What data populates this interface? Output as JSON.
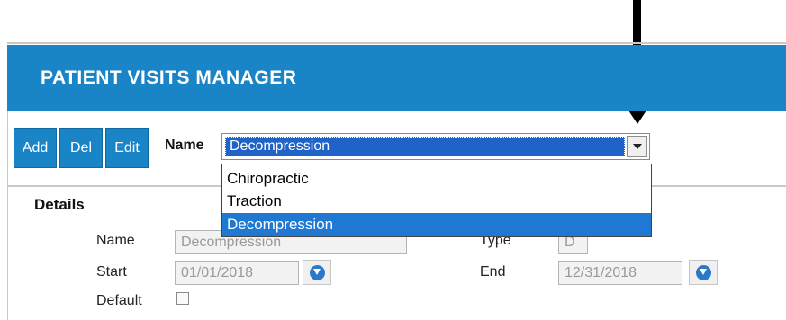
{
  "window": {
    "title": "PATIENT VISITS MANAGER"
  },
  "toolbar": {
    "add_label": "Add",
    "del_label": "Del",
    "edit_label": "Edit"
  },
  "name_selector": {
    "label": "Name",
    "selected": "Decompression",
    "options": [
      "Chiropractic",
      "Traction",
      "Decompression"
    ],
    "highlighted_index": 2
  },
  "details": {
    "title": "Details",
    "name_label": "Name",
    "name_value": "Decompression",
    "type_label": "Type",
    "type_value": "D",
    "start_label": "Start",
    "start_value": "01/01/2018",
    "end_label": "End",
    "end_value": "12/31/2018",
    "default_label": "Default",
    "default_checked": false
  },
  "colors": {
    "accent": "#1a85c6",
    "selection": "#1f78d1"
  },
  "icons": {
    "date_picker": "down-arrow-circle-icon",
    "combo": "chevron-down-icon",
    "annotation": "arrow-down-icon"
  }
}
